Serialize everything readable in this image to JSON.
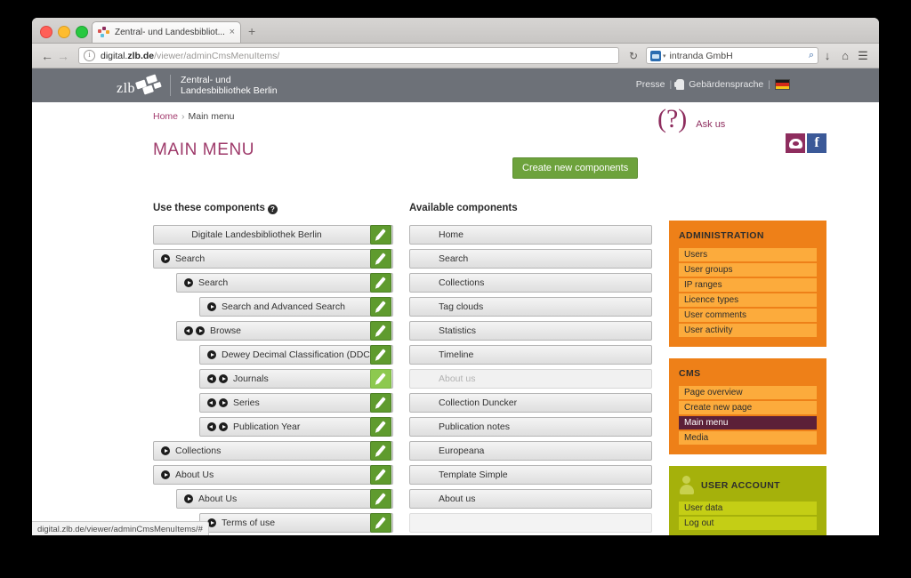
{
  "browser": {
    "tab_title": "Zentral- und Landesbibliot...",
    "tab_close": "×",
    "new_tab": "+",
    "back": "←",
    "forward": "→",
    "url_scheme_host": "digital.",
    "url_host_bold": "zlb.de",
    "url_path": "/viewer/adminCmsMenuItems/",
    "info_icon": "i",
    "reload": "↻",
    "search_engine": "intranda GmbH",
    "search_caret": "▾",
    "magnifier": "⌕",
    "download_icon": "↓",
    "home_icon": "⌂",
    "menu_icon": "☰",
    "status_url": "digital.zlb.de/viewer/adminCmsMenuItems/#"
  },
  "site_header": {
    "logo_text_line1": "Zentral- und",
    "logo_text_line2": "Landesbibliothek Berlin",
    "logo_wordmark": "zlb",
    "links": {
      "presse": "Presse",
      "separator": "|",
      "sign_language": "Gebärdensprache"
    }
  },
  "breadcrumb": {
    "home": "Home",
    "chevron": "›",
    "current": "Main menu"
  },
  "page_title": "MAIN MENU",
  "ask_us": {
    "question_mark": "(?)",
    "label": "Ask us",
    "facebook": "f"
  },
  "create_button": "Create new components",
  "columns": {
    "left_heading": "Use these components",
    "help_glyph": "?",
    "right_heading": "Available components"
  },
  "used_components": [
    {
      "label": "Digitale Landesbibliothek Berlin",
      "indent": 0,
      "handles": [],
      "centered": true,
      "edit_hover": false
    },
    {
      "label": "Search",
      "indent": 0,
      "handles": [
        "right"
      ],
      "centered": false,
      "edit_hover": false
    },
    {
      "label": "Search",
      "indent": 1,
      "handles": [
        "right"
      ],
      "centered": false,
      "edit_hover": false
    },
    {
      "label": "Search and Advanced Search",
      "indent": 2,
      "handles": [
        "right"
      ],
      "centered": false,
      "edit_hover": false
    },
    {
      "label": "Browse",
      "indent": 1,
      "handles": [
        "left",
        "right"
      ],
      "centered": false,
      "edit_hover": false
    },
    {
      "label": "Dewey Decimal Classification (DDC)",
      "indent": 2,
      "handles": [
        "right"
      ],
      "centered": false,
      "edit_hover": false
    },
    {
      "label": "Journals",
      "indent": 2,
      "handles": [
        "left",
        "right"
      ],
      "centered": false,
      "edit_hover": true
    },
    {
      "label": "Series",
      "indent": 2,
      "handles": [
        "left",
        "right"
      ],
      "centered": false,
      "edit_hover": false
    },
    {
      "label": "Publication Year",
      "indent": 2,
      "handles": [
        "left",
        "right"
      ],
      "centered": false,
      "edit_hover": false
    },
    {
      "label": "Collections",
      "indent": 0,
      "handles": [
        "right"
      ],
      "centered": false,
      "edit_hover": false
    },
    {
      "label": "About Us",
      "indent": 0,
      "handles": [
        "right"
      ],
      "centered": false,
      "edit_hover": false
    },
    {
      "label": "About Us",
      "indent": 1,
      "handles": [
        "right"
      ],
      "centered": false,
      "edit_hover": false
    },
    {
      "label": "Terms of use",
      "indent": 2,
      "handles": [
        "right"
      ],
      "centered": false,
      "edit_hover": false
    }
  ],
  "available_components": [
    {
      "label": "Home",
      "disabled": false
    },
    {
      "label": "Search",
      "disabled": false
    },
    {
      "label": "Collections",
      "disabled": false
    },
    {
      "label": "Tag clouds",
      "disabled": false
    },
    {
      "label": "Statistics",
      "disabled": false
    },
    {
      "label": "Timeline",
      "disabled": false
    },
    {
      "label": "About us",
      "disabled": true
    },
    {
      "label": "Collection Duncker",
      "disabled": false
    },
    {
      "label": "Publication notes",
      "disabled": false
    },
    {
      "label": "Europeana",
      "disabled": false
    },
    {
      "label": "Template Simple",
      "disabled": false
    },
    {
      "label": "About us",
      "disabled": false
    },
    {
      "label": "",
      "disabled": false
    }
  ],
  "sidebar": {
    "panels": [
      {
        "title": "ADMINISTRATION",
        "style": "orange",
        "items": [
          {
            "label": "Users",
            "active": false
          },
          {
            "label": "User groups",
            "active": false
          },
          {
            "label": "IP ranges",
            "active": false
          },
          {
            "label": "Licence types",
            "active": false
          },
          {
            "label": "User comments",
            "active": false
          },
          {
            "label": "User activity",
            "active": false
          }
        ]
      },
      {
        "title": "CMS",
        "style": "orange",
        "items": [
          {
            "label": "Page overview",
            "active": false
          },
          {
            "label": "Create new page",
            "active": false
          },
          {
            "label": "Main menu",
            "active": true
          },
          {
            "label": "Media",
            "active": false
          }
        ]
      },
      {
        "title": "USER ACCOUNT",
        "style": "olive",
        "items": [
          {
            "label": "User data",
            "active": false
          },
          {
            "label": "Log out",
            "active": false
          }
        ]
      }
    ]
  },
  "colors": {
    "header_bg": "#6d7178",
    "accent_orange": "#f0a52c",
    "brand_purple": "#9e3a6a",
    "green": "#6da23c",
    "panel_orange": "#ee8018",
    "panel_olive": "#a5b10b",
    "active_item": "#5c2038"
  }
}
